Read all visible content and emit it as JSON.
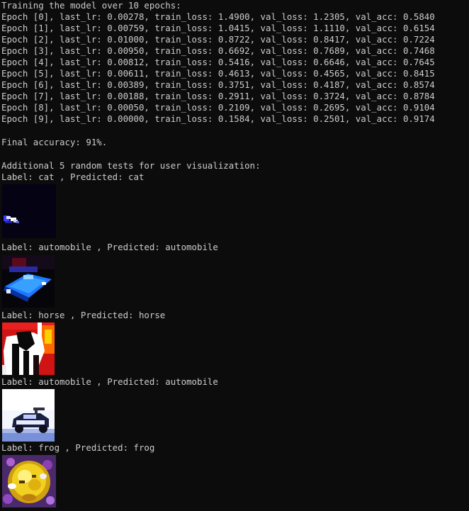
{
  "header": "Training the model over 10 epochs:",
  "epochs": [
    "Epoch [0], last_lr: 0.00278, train_loss: 1.4900, val_loss: 1.2305, val_acc: 0.5840",
    "Epoch [1], last_lr: 0.00759, train_loss: 1.0415, val_loss: 1.1110, val_acc: 0.6154",
    "Epoch [2], last_lr: 0.01000, train_loss: 0.8722, val_loss: 0.8417, val_acc: 0.7224",
    "Epoch [3], last_lr: 0.00950, train_loss: 0.6692, val_loss: 0.7689, val_acc: 0.7468",
    "Epoch [4], last_lr: 0.00812, train_loss: 0.5416, val_loss: 0.6646, val_acc: 0.7645",
    "Epoch [5], last_lr: 0.00611, train_loss: 0.4613, val_loss: 0.4565, val_acc: 0.8415",
    "Epoch [6], last_lr: 0.00389, train_loss: 0.3751, val_loss: 0.4187, val_acc: 0.8574",
    "Epoch [7], last_lr: 0.00188, train_loss: 0.2911, val_loss: 0.3724, val_acc: 0.8784",
    "Epoch [8], last_lr: 0.00050, train_loss: 0.2109, val_loss: 0.2695, val_acc: 0.9104",
    "Epoch [9], last_lr: 0.00000, train_loss: 0.1584, val_loss: 0.2501, val_acc: 0.9174"
  ],
  "final_accuracy": "Final accuracy: 91%.",
  "additional_tests_header": "Additional 5 random tests for user visualization:",
  "tests": [
    {
      "label": "Label: cat , Predicted: cat",
      "image": "cat-thumbnail"
    },
    {
      "label": "Label: automobile , Predicted: automobile",
      "image": "automobile-thumbnail"
    },
    {
      "label": "Label: horse , Predicted: horse",
      "image": "horse-thumbnail"
    },
    {
      "label": "Label: automobile , Predicted: automobile",
      "image": "automobile-thumbnail"
    },
    {
      "label": "Label: frog , Predicted: frog",
      "image": "frog-thumbnail"
    }
  ],
  "colors": {
    "background": "#0c0c0c",
    "text": "#cccccc"
  }
}
